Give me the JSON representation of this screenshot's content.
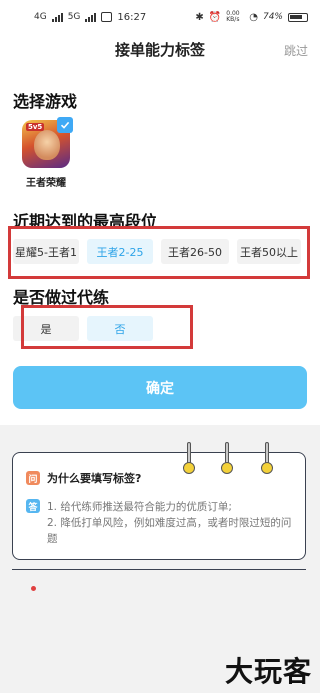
{
  "status_bar": {
    "network_1": "4G",
    "network_2": "5G",
    "time": "16:27",
    "speed": "0.00 KB/s",
    "battery": "74%"
  },
  "nav": {
    "title": "接单能力标签",
    "skip": "跳过"
  },
  "game_section": {
    "title": "选择游戏",
    "game": {
      "name": "王者荣耀",
      "selected": true,
      "badge": "5v5"
    }
  },
  "rank_section": {
    "title": "近期达到的最高段位",
    "options": [
      "星耀5-王者1",
      "王者2-25",
      "王者26-50",
      "王者50以上"
    ],
    "selected": "王者2-25"
  },
  "boost_section": {
    "title": "是否做过代练",
    "options": [
      "是",
      "否"
    ],
    "selected": "否"
  },
  "confirm_label": "确定",
  "note": {
    "q_icon": "问",
    "a_icon": "答",
    "question": "为什么要填写标签?",
    "answer_1": "1. 给代练师推送最符合能力的优质订单;",
    "answer_2": "2. 降低打单风险，例如难度过高，或者时限过短的问题"
  },
  "watermark": "大玩客",
  "colors": {
    "accent": "#5cc4f5",
    "selected_text": "#2ea4e8",
    "selected_bg": "#e6f5fd",
    "highlight_box": "#d33a3a"
  }
}
